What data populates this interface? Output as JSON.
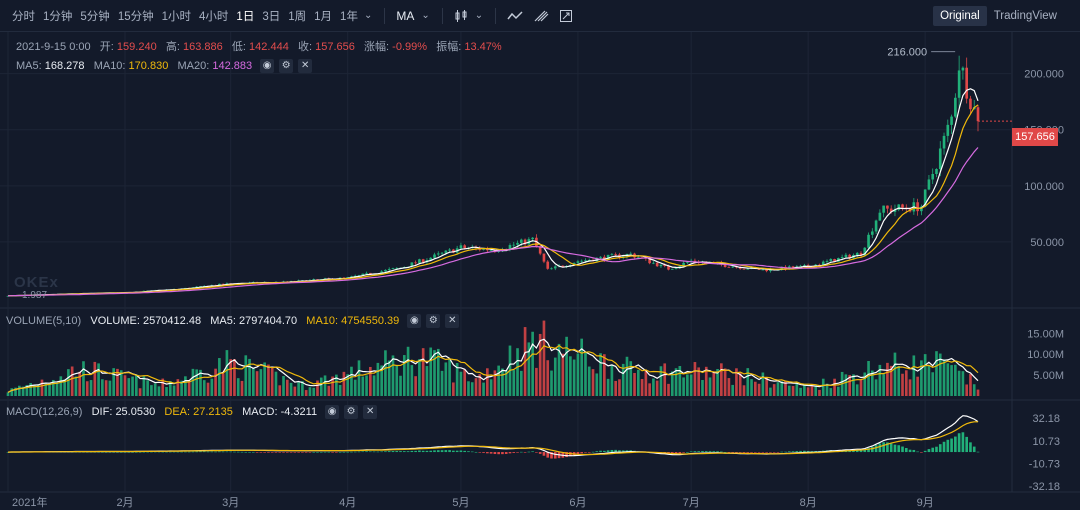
{
  "toolbar": {
    "timeframes": [
      "分时",
      "1分钟",
      "5分钟",
      "15分钟",
      "1小时",
      "4小时",
      "1日",
      "3日",
      "1周",
      "1月",
      "1年"
    ],
    "active_timeframe": "1日",
    "indicator": "MA",
    "modes": [
      "Original",
      "TradingView"
    ],
    "active_mode": "Original"
  },
  "ohlc": {
    "date": "2021-9-15 0:00",
    "open_label": "开:",
    "open": "159.240",
    "high_label": "高:",
    "high": "163.886",
    "low_label": "低:",
    "low": "142.444",
    "close_label": "收:",
    "close": "157.656",
    "change_label": "涨幅:",
    "change": "-0.99%",
    "amp_label": "振幅:",
    "amp": "13.47%"
  },
  "ma_legend": {
    "ma5_label": "MA5:",
    "ma5": "168.278",
    "ma10_label": "MA10:",
    "ma10": "170.830",
    "ma20_label": "MA20:",
    "ma20": "142.883"
  },
  "volume_legend": {
    "title": "VOLUME(5,10)",
    "vol_label": "VOLUME:",
    "vol": "2570412.48",
    "ma5_label": "MA5:",
    "ma5": "2797404.70",
    "ma10_label": "MA10:",
    "ma10": "4754550.39"
  },
  "macd_legend": {
    "title": "MACD(12,26,9)",
    "dif_label": "DIF:",
    "dif": "25.0530",
    "dea_label": "DEA:",
    "dea": "27.2135",
    "macd_label": "MACD:",
    "macd": "-4.3211"
  },
  "watermark": "OKEx",
  "colors": {
    "bg": "#131a2a",
    "up": "#21b17a",
    "down": "#e04848",
    "ma5": "#ffffff",
    "ma10": "#f0b90b",
    "ma20": "#d66be0",
    "grid": "#1d2536"
  },
  "chart_data": {
    "type": "candlestick",
    "x_ticks": [
      "2021年",
      "2月",
      "3月",
      "4月",
      "5月",
      "6月",
      "7月",
      "8月",
      "9月"
    ],
    "price_axis": {
      "ticks": [
        50,
        100,
        150,
        200
      ],
      "tick_labels": [
        "50.000",
        "100.000",
        "150.000",
        "200.000"
      ],
      "range": [
        0,
        230
      ]
    },
    "high_marker": {
      "value": 216.0,
      "label": "216.000"
    },
    "low_marker": {
      "value": 1.987,
      "label": "1.987"
    },
    "last_price": {
      "value": 157.656,
      "label": "157.656"
    },
    "volume_axis": {
      "ticks": [
        5000000,
        10000000,
        15000000
      ],
      "tick_labels": [
        "5.00M",
        "10.00M",
        "15.00M"
      ],
      "range": [
        0,
        17000000
      ]
    },
    "macd_axis": {
      "ticks": [
        32.18,
        10.73,
        -10.73,
        -32.18
      ],
      "tick_labels": [
        "32.18",
        "10.73",
        "-10.73",
        "-32.18"
      ],
      "range": [
        -38,
        40
      ]
    },
    "price_anchors": [
      {
        "date": "2021-01-01",
        "close": 2.0
      },
      {
        "date": "2021-01-15",
        "close": 3.5
      },
      {
        "date": "2021-02-01",
        "close": 5.0
      },
      {
        "date": "2021-02-15",
        "close": 8.0
      },
      {
        "date": "2021-03-01",
        "close": 13.0
      },
      {
        "date": "2021-03-15",
        "close": 14.0
      },
      {
        "date": "2021-04-01",
        "close": 18.0
      },
      {
        "date": "2021-04-15",
        "close": 27.0
      },
      {
        "date": "2021-05-01",
        "close": 45.0
      },
      {
        "date": "2021-05-10",
        "close": 43.0
      },
      {
        "date": "2021-05-20",
        "close": 52.0
      },
      {
        "date": "2021-05-24",
        "close": 25.0
      },
      {
        "date": "2021-06-01",
        "close": 33.0
      },
      {
        "date": "2021-06-15",
        "close": 39.0
      },
      {
        "date": "2021-06-25",
        "close": 26.0
      },
      {
        "date": "2021-07-01",
        "close": 33.0
      },
      {
        "date": "2021-07-20",
        "close": 25.0
      },
      {
        "date": "2021-08-01",
        "close": 28.0
      },
      {
        "date": "2021-08-15",
        "close": 40.0
      },
      {
        "date": "2021-08-20",
        "close": 78.0
      },
      {
        "date": "2021-08-31",
        "close": 82.0
      },
      {
        "date": "2021-09-08",
        "close": 160.0
      },
      {
        "date": "2021-09-10",
        "close": 210.0
      },
      {
        "date": "2021-09-15",
        "close": 157.656
      }
    ],
    "volume_anchors": [
      {
        "date": "2021-01-01",
        "value": 1200000
      },
      {
        "date": "2021-01-20",
        "value": 6500000
      },
      {
        "date": "2021-02-10",
        "value": 2500000
      },
      {
        "date": "2021-03-01",
        "value": 8000000
      },
      {
        "date": "2021-03-20",
        "value": 2500000
      },
      {
        "date": "2021-04-20",
        "value": 9500000
      },
      {
        "date": "2021-05-05",
        "value": 4000000
      },
      {
        "date": "2021-05-20",
        "value": 13000000
      },
      {
        "date": "2021-06-15",
        "value": 6000000
      },
      {
        "date": "2021-07-10",
        "value": 5500000
      },
      {
        "date": "2021-08-01",
        "value": 2000000
      },
      {
        "date": "2021-08-20",
        "value": 7000000
      },
      {
        "date": "2021-09-05",
        "value": 7500000
      },
      {
        "date": "2021-09-15",
        "value": 2570412
      }
    ]
  }
}
